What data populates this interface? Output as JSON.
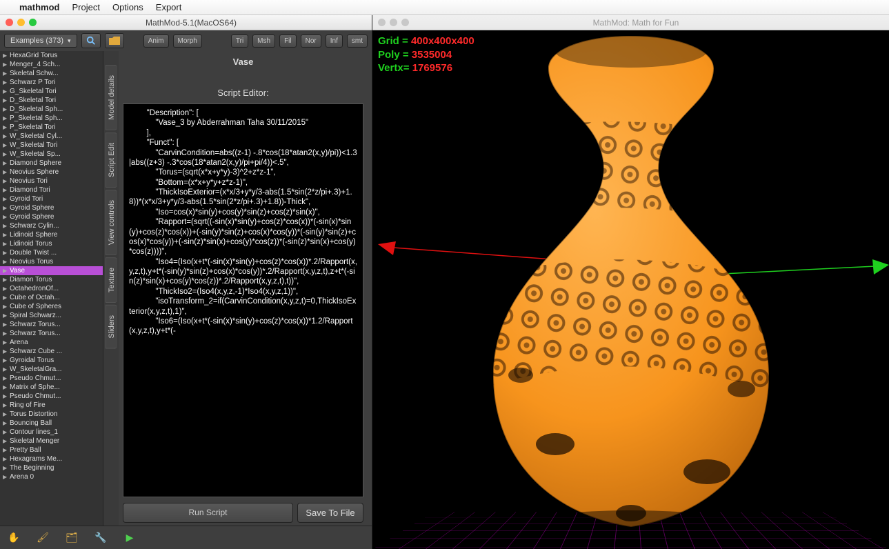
{
  "mac_menu": {
    "app": "mathmod",
    "items": [
      "Project",
      "Options",
      "Export"
    ]
  },
  "left_window": {
    "title": "MathMod-5.1(MacOS64)",
    "examples_label": "Examples (373)",
    "anim": "Anim",
    "morph": "Morph",
    "mode_buttons": [
      "Tri",
      "Msh",
      "Fil",
      "Nor",
      "Inf",
      "smt"
    ],
    "model_title": "Vase",
    "script_title": "Script Editor:",
    "run": "Run Script",
    "save": "Save To File",
    "script_text": "        \"Description\": [\n            \"Vase_3 by Abderrahman Taha 30/11/2015\"\n        ],\n        \"Funct\": [\n            \"CarvinCondition=abs((z-1) -.8*cos(18*atan2(x,y)/pi))<1.3|abs((z+3) -.3*cos(18*atan2(x,y)/pi+pi/4))<.5\",\n            \"Torus=(sqrt(x*x+y*y)-3)^2+z*z-1\",\n            \"Bottom=(x*x+y*y+z*z-1)\",\n            \"ThickIsoExterior=(x*x/3+y*y/3-abs(1.5*sin(2*z/pi+.3)+1.8))*(x*x/3+y*y/3-abs(1.5*sin(2*z/pi+.3)+1.8))-Thick\",\n            \"Iso=cos(x)*sin(y)+cos(y)*sin(z)+cos(z)*sin(x)\",\n            \"Rapport=(sqrt((-sin(x)*sin(y)+cos(z)*cos(x))*(-sin(x)*sin(y)+cos(z)*cos(x))+(-sin(y)*sin(z)+cos(x)*cos(y))*(-sin(y)*sin(z)+cos(x)*cos(y))+(-sin(z)*sin(x)+cos(y)*cos(z))*(-sin(z)*sin(x)+cos(y)*cos(z))))\",\n            \"Iso4=(Iso(x+t*(-sin(x)*sin(y)+cos(z)*cos(x))*.2/Rapport(x,y,z,t),y+t*(-sin(y)*sin(z)+cos(x)*cos(y))*.2/Rapport(x,y,z,t),z+t*(-sin(z)*sin(x)+cos(y)*cos(z))*.2/Rapport(x,y,z,t),t))\",\n            \"ThickIso2=(Iso4(x,y,z,-1)*Iso4(x,y,z,1))\",\n            \"isoTransform_2=if(CarvinCondition(x,y,z,t)=0,ThickIsoExterior(x,y,z,t),1)\",\n            \"Iso6=(Iso(x+t*(-sin(x)*sin(y)+cos(z)*cos(x))*1.2/Rapport(x,y,z,t),y+t*(-"
  },
  "side_tabs": [
    "Model details",
    "Script Edit",
    "View controls",
    "Texture",
    "Sliders"
  ],
  "tree": {
    "selected": "Vase",
    "items": [
      "HexaGrid Torus",
      "Menger_4 Sch...",
      "Skeletal Schw...",
      "Schwarz P Tori",
      "G_Skeletal Tori",
      "D_Skeletal Tori",
      "D_Skeletal Sph...",
      "P_Skeletal Sph...",
      "P_Skeletal Tori",
      "W_Skeletal Cyl...",
      "W_Skeletal Tori",
      "W_Skeletal Sp...",
      "Diamond Sphere",
      "Neovius Sphere",
      "Neovius Tori",
      "Diamond Tori",
      "Gyroid Tori",
      "Gyroid Sphere",
      "Gyroid Sphere",
      "Schwarz Cylin...",
      "Lidinoid Sphere",
      "Lidinoid Torus",
      "Double Twist ...",
      "Neovius Torus",
      "Vase",
      "Diamon Torus",
      "OctahedronOf...",
      "Cube of Octah...",
      "Cube of Spheres",
      "Spiral Schwarz...",
      "Schwarz Torus...",
      "Schwarz Torus...",
      "Arena",
      "Schwarz Cube ...",
      "Gyroidal Torus",
      "W_SkeletalGra...",
      "Pseudo Chmut...",
      "Matrix of Sphe...",
      "Pseudo Chmut...",
      "Ring of Fire",
      "Torus Distortion",
      "Bouncing Ball",
      "Contour lines_1",
      "Skeletal Menger",
      "Pretty Ball",
      "Hexagrams Me...",
      "The Beginning",
      "Arena 0"
    ]
  },
  "right_window": {
    "title": "MathMod: Math for Fun",
    "grid_label": "Grid  =",
    "grid_value": "400x400x400",
    "poly_label": "Poly  =",
    "poly_value": "3535004",
    "vert_label": "Vertx=",
    "vert_value": "1769576"
  },
  "colors": {
    "vase": "#f7941d",
    "vase_dark": "#c96a0a"
  }
}
